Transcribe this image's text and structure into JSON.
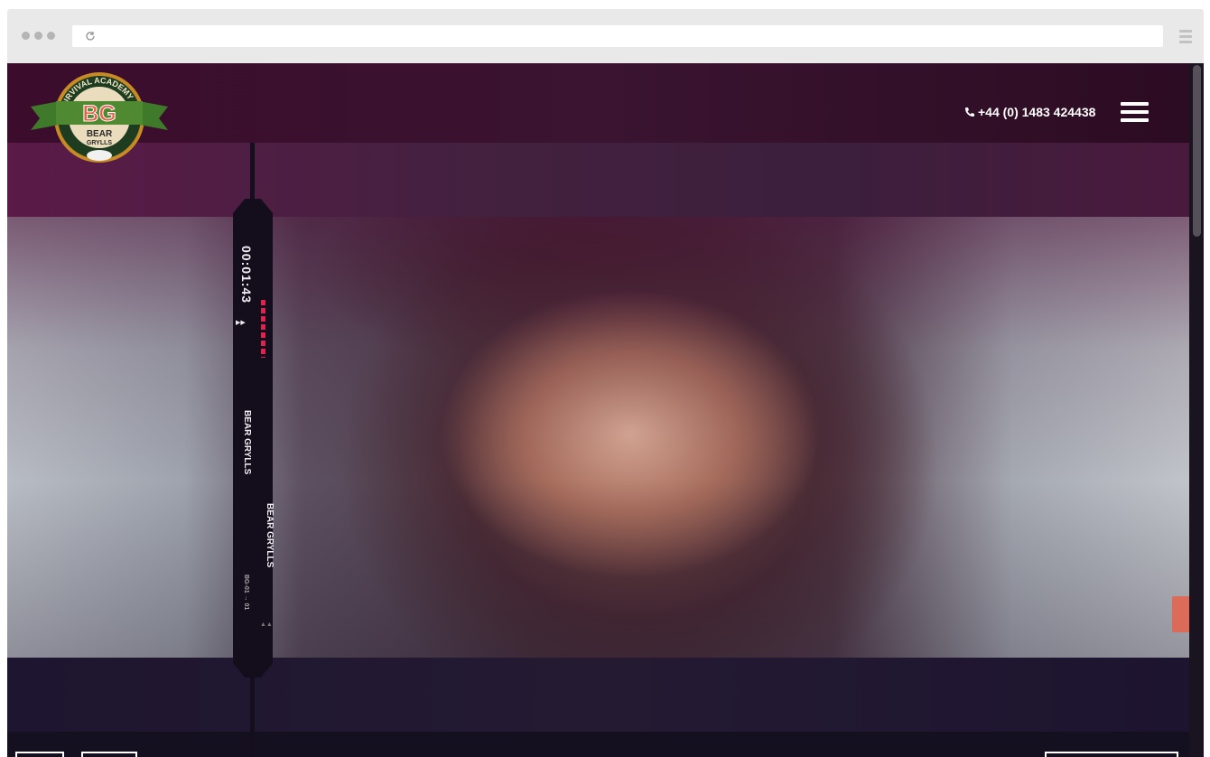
{
  "header": {
    "logo_top_text": "SURVIVAL ACADEMY",
    "logo_initials": "BG",
    "logo_name_1": "BEAR",
    "logo_name_2": "GRYLLS",
    "phone_icon": "phone-icon",
    "phone_number": "+44 (0) 1483 424438",
    "menu_icon": "hamburger-menu-icon"
  },
  "hud": {
    "timecode": "00:01:43",
    "name_1": "BEAR GRYLLS",
    "name_2": "BEAR GRYLLS",
    "tag": "BG-01 → 01"
  },
  "colors": {
    "top_band": "#3b0c2c",
    "hud": "#140d1c",
    "accent_red": "#e2214e",
    "logo_green": "#3f7a2a",
    "logo_orange": "#e8614b"
  },
  "browser": {
    "reload_icon": "reload-icon",
    "menu_icon": "browser-menu-icon"
  }
}
